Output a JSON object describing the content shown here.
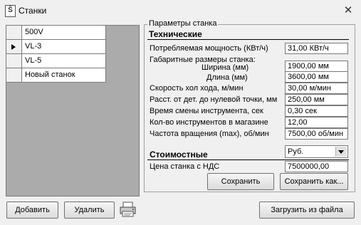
{
  "window": {
    "title": "Станки",
    "app_icon_glyph": "Ŝ",
    "close_glyph": "✕"
  },
  "machine_list": {
    "selected_index": 1,
    "rows": [
      "500V",
      "VL-3",
      "VL-5",
      "Новый станок"
    ]
  },
  "params_group": {
    "title": "Параметры станка",
    "technical": {
      "heading": "Технические",
      "power": {
        "label": "Потребляемая мощность (КВт/ч)",
        "value": "31,00 КВт/ч"
      },
      "dimensions_label": "Габаритные размеры станка:",
      "width": {
        "label": "Ширина (мм)",
        "value": "1900,00 мм"
      },
      "length": {
        "label": "Длина (мм)",
        "value": "3600,00 мм"
      },
      "idle_speed": {
        "label": "Скорость хол хода, м/мин",
        "value": "30,00 м/мин"
      },
      "zero_dist": {
        "label": "Расст. от дет. до нулевой точки, мм",
        "value": "250,00 мм"
      },
      "tool_change": {
        "label": "Время смены инструмента, сек",
        "value": "0,30 сек"
      },
      "tool_count": {
        "label": "Кол-во инструментов в магазине",
        "value": "12,00"
      },
      "spindle": {
        "label": "Частота вращения (max), об/мин",
        "value": "7500,00 об/мин"
      }
    },
    "cost": {
      "heading": "Стоимостные",
      "currency": "Руб.",
      "price": {
        "label": "Цена станка с НДС",
        "value": "7500000,00"
      }
    },
    "save_label": "Сохранить",
    "save_as_label": "Сохранить как..."
  },
  "bottom": {
    "add_label": "Добавить",
    "delete_label": "Удалить",
    "load_label": "Загрузить из файла"
  },
  "icons": {
    "printer": "printer-icon"
  }
}
